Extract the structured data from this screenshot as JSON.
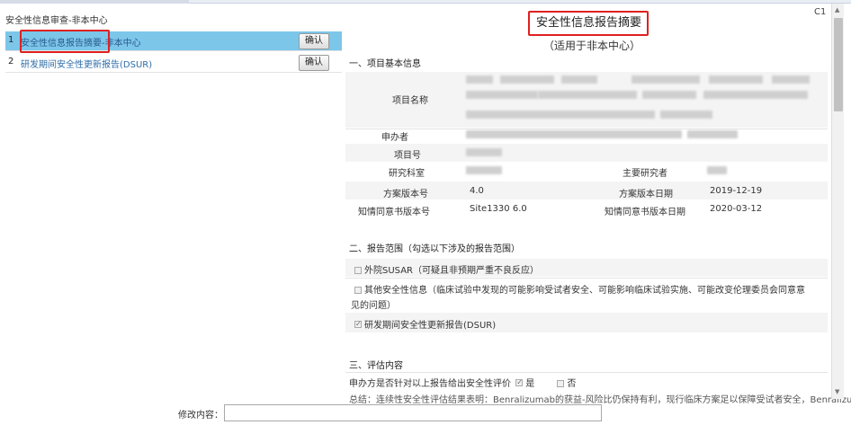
{
  "left_panel": {
    "title": "安全性信息审查-非本中心",
    "items": [
      {
        "num": "1",
        "label": "安全性信息报告摘要-非本中心",
        "button": "确认"
      },
      {
        "num": "2",
        "label": "研发期间安全性更新报告(DSUR)",
        "button": "确认"
      }
    ]
  },
  "page_number": "C1",
  "report": {
    "title": "安全性信息报告摘要",
    "subtitle": "（适用于非本中心）",
    "section1": {
      "heading": "一、项目基本信息",
      "project_name_label": "项目名称",
      "applicant_label": "申办者",
      "project_no_label": "项目号",
      "department_label": "研究科室",
      "pi_label": "主要研究者",
      "protocol_version_label": "方案版本号",
      "protocol_version_value": "4.0",
      "protocol_date_label": "方案版本日期",
      "protocol_date_value": "2019-12-19",
      "icf_version_label": "知情同意书版本号",
      "icf_version_value": "Site1330 6.0",
      "icf_date_label": "知情同意书版本日期",
      "icf_date_value": "2020-03-12"
    },
    "section2": {
      "heading": "二、报告范围（勾选以下涉及的报告范围）",
      "opt1": "外院SUSAR（可疑且非预期严重不良反应）",
      "opt2_line1": "其他安全性信息（临床试验中发现的可能影响受试者安全、可能影响临床试验实施、可能改变伦理委员会同意意",
      "opt2_line2": "见的问题）",
      "opt3": "研发期间安全性更新报告(DSUR)"
    },
    "section3": {
      "heading": "三、评估内容",
      "question": "申办方是否针对以上报告给出安全性评价",
      "yes": "是",
      "no": "否",
      "conclusion": "总结：连续性安全性评估结果表明：Benralizumab的获益-风险比仍保持有利，现行临床方案足以保障受试者安全，Benralizumab"
    }
  },
  "footer": {
    "modify_label": "修改内容："
  }
}
